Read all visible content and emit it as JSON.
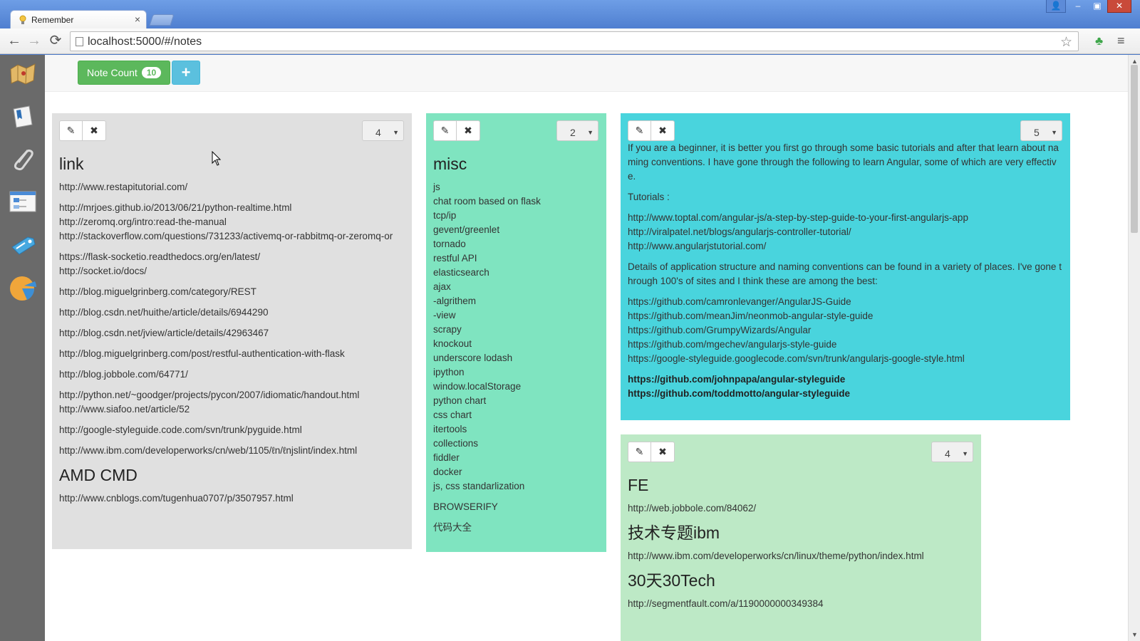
{
  "browser": {
    "tab_title": "Remember",
    "tab_close": "×",
    "url": "localhost:5000/#/notes",
    "icons": {
      "back": "←",
      "forward": "→",
      "reload": "⟳",
      "star": "☆",
      "extension": "♣",
      "menu": "≡"
    },
    "window_controls": {
      "user": "👤",
      "minimize": "–",
      "maximize": "▣",
      "close": "✕"
    }
  },
  "sidebar": {
    "items": [
      {
        "icon": "map-icon"
      },
      {
        "icon": "notebook-icon"
      },
      {
        "icon": "paperclip-icon"
      },
      {
        "icon": "diagram-icon"
      },
      {
        "icon": "tag-icon"
      },
      {
        "icon": "pie-chart-icon"
      }
    ]
  },
  "topbar": {
    "count_label": "Note Count",
    "count_value": "10",
    "add_label": "+"
  },
  "colors": {
    "gray": "#e0e0e0",
    "mint": "#7fe4c0",
    "cyan": "#49d4dd",
    "light": "#bde9c6",
    "green_btn": "#5cb85c",
    "blue_btn": "#5bc0de"
  },
  "tools": {
    "edit": "✎",
    "delete": "✖",
    "caret": "▼"
  },
  "notes": {
    "link": {
      "size": "4",
      "title": "link",
      "url1": "http://www.restapitutorial.com/",
      "url2": "http://mrjoes.github.io/2013/06/21/python-realtime.html",
      "url3": "http://zeromq.org/intro:read-the-manual",
      "url4": "http://stackoverflow.com/questions/731233/activemq-or-rabbitmq-or-zeromq-or",
      "url5": "https://flask-socketio.readthedocs.org/en/latest/",
      "url6": "http://socket.io/docs/",
      "url7": "http://blog.miguelgrinberg.com/category/REST",
      "url8": "http://blog.csdn.net/huithe/article/details/6944290",
      "url9": "http://blog.csdn.net/jview/article/details/42963467",
      "url10": "http://blog.miguelgrinberg.com/post/restful-authentication-with-flask",
      "url11": "http://blog.jobbole.com/64771/",
      "url12": "http://python.net/~goodger/projects/pycon/2007/idiomatic/handout.html",
      "url13": "http://www.siafoo.net/article/52",
      "url14": "http://google-styleguide.code.com/svn/trunk/pyguide.html",
      "url15": "http://www.ibm.com/developerworks/cn/web/1105/ℓn/ℓnjslint/index.html",
      "title2": "AMD CMD",
      "url16": "http://www.cnblogs.com/tugenhua0707/p/3507957.html"
    },
    "misc": {
      "size": "2",
      "title": "misc",
      "items": [
        "js",
        "chat room based on flask",
        "tcp/ip",
        "gevent/greenlet",
        "tornado",
        "restful API",
        "elasticsearch",
        "ajax",
        "-algrithem",
        "-view",
        "scrapy",
        "knockout",
        "underscore lodash",
        "ipython",
        "window.localStorage",
        "python chart",
        "css chart",
        "itertools",
        "collections",
        "fiddler",
        "docker",
        "js, css standarlization"
      ],
      "extra1": "BROWSERIFY",
      "extra2": "代码大全"
    },
    "angular": {
      "size": "5",
      "intro": "If you are a beginner, it is better you first go through some basic tutorials and after that learn about naming conventions. I have gone through the following to learn Angular, some of which are very effective.",
      "tutorials_label": "Tutorials :",
      "tut1": "http://www.toptal.com/angular-js/a-step-by-step-guide-to-your-first-angularjs-app",
      "tut2": "http://viralpatel.net/blogs/angularjs-controller-tutorial/",
      "tut3": "http://www.angularjstutorial.com/",
      "details": "Details of application structure and naming conventions can be found in a variety of places. I've gone through 100's of sites and I think these are among the best:",
      "g1": "https://github.com/camronlevanger/AngularJS-Guide",
      "g2": "https://github.com/meanJim/neonmob-angular-style-guide",
      "g3": "https://github.com/GrumpyWizards/Angular",
      "g4": "https://github.com/mgechev/angularjs-style-guide",
      "g5": "https://google-styleguide.googlecode.com/svn/trunk/angularjs-google-style.html",
      "b1": "https://github.com/johnpapa/angular-styleguide",
      "b2": "https://github.com/toddmotto/angular-styleguide"
    },
    "fe": {
      "size": "4",
      "title": "FE",
      "url1": "http://web.jobbole.com/84062/",
      "title2": "技术专题ibm",
      "url2": "http://www.ibm.com/developerworks/cn/linux/theme/python/index.html",
      "title3": "30天30Tech",
      "url3": "http://segmentfault.com/a/1190000000349384"
    }
  }
}
